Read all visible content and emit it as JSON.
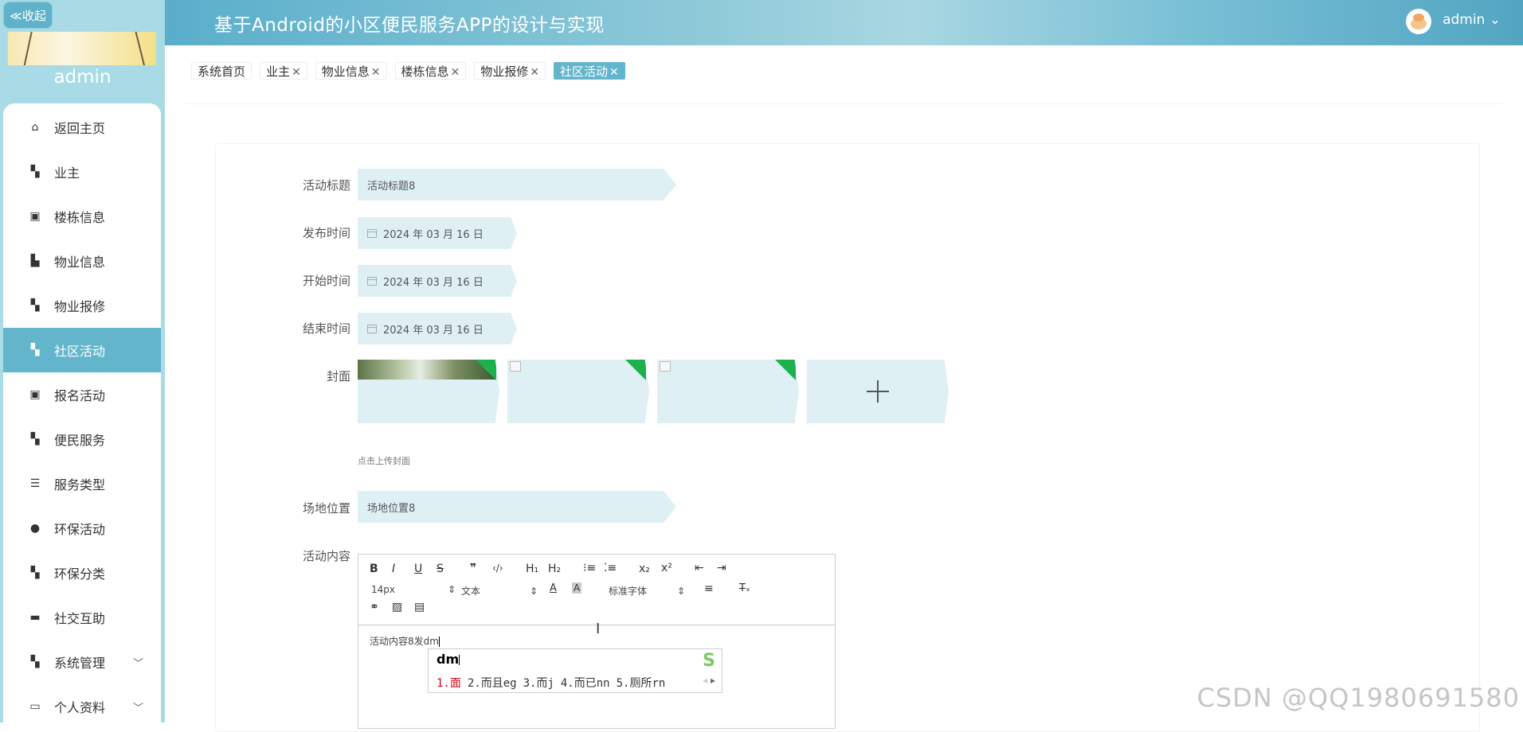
{
  "sidebar": {
    "collapse_label": "≪收起",
    "username": "admin",
    "items": [
      {
        "label": "返回主页",
        "icon": "home-icon"
      },
      {
        "label": "业主",
        "icon": "grid-icon"
      },
      {
        "label": "楼栋信息",
        "icon": "clipboard-icon"
      },
      {
        "label": "物业信息",
        "icon": "book-icon"
      },
      {
        "label": "物业报修",
        "icon": "grid-icon"
      },
      {
        "label": "社区活动",
        "icon": "grid-icon",
        "active": true
      },
      {
        "label": "报名活动",
        "icon": "clipboard-icon"
      },
      {
        "label": "便民服务",
        "icon": "grid-icon"
      },
      {
        "label": "服务类型",
        "icon": "list-icon"
      },
      {
        "label": "环保活动",
        "icon": "leaf-icon"
      },
      {
        "label": "环保分类",
        "icon": "grid-icon"
      },
      {
        "label": "社交互助",
        "icon": "chat-icon"
      },
      {
        "label": "系统管理",
        "icon": "grid-icon"
      },
      {
        "label": "个人资料",
        "icon": "profile-icon"
      }
    ]
  },
  "header": {
    "title": "基于Android的小区便民服务APP的设计与实现",
    "user": "admin"
  },
  "tabs": [
    {
      "label": "系统首页",
      "closable": false
    },
    {
      "label": "业主",
      "closable": true
    },
    {
      "label": "物业信息",
      "closable": true
    },
    {
      "label": "楼栋信息",
      "closable": true
    },
    {
      "label": "物业报修",
      "closable": true
    },
    {
      "label": "社区活动",
      "closable": true,
      "active": true
    }
  ],
  "form": {
    "title_label": "活动标题",
    "title_value": "活动标题8",
    "publish_label": "发布时间",
    "publish_value": "2024 年 03 月 16 日",
    "start_label": "开始时间",
    "start_value": "2024 年 03 月 16 日",
    "end_label": "结束时间",
    "end_value": "2024 年 03 月 16 日",
    "cover_label": "封面",
    "cover_hint": "点击上传封面",
    "location_label": "场地位置",
    "location_value": "场地位置8",
    "content_label": "活动内容"
  },
  "editor": {
    "font_size": "14px",
    "block_type": "文本",
    "font_family": "标准字体",
    "content": "活动内容8发dm"
  },
  "ime": {
    "composition": "dm",
    "candidates": [
      "1.面",
      "2.而且eg",
      "3.而j",
      "4.而已nn",
      "5.厕所rn"
    ]
  },
  "watermark": "CSDN @QQ1980691580"
}
